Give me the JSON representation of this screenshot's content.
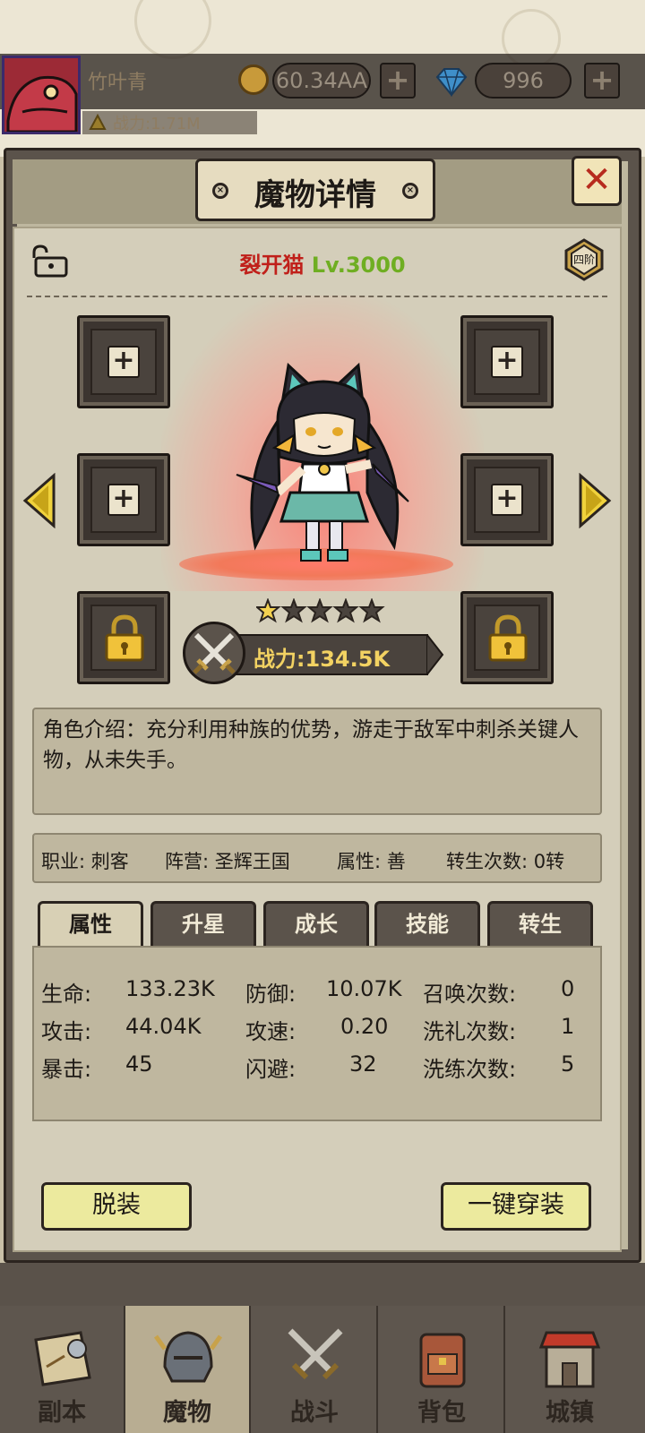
{
  "player": {
    "name": "竹叶青",
    "power": "战力:1.71M",
    "gold": "60.34AA",
    "gems": "996"
  },
  "dialog": {
    "title": "魔物详情"
  },
  "monster": {
    "name": "裂开猫",
    "level": "Lv.3000",
    "tier": "四阶",
    "stars_filled": 1,
    "stars_total": 5,
    "power": "战力:134.5K",
    "description": "角色介绍：充分利用种族的优势，游走于敌军中刺杀关键人物，从未失手。"
  },
  "info": {
    "job": "职业: 刺客",
    "faction": "阵营: 圣辉王国",
    "attribute": "属性: 善",
    "rebirth": "转生次数: 0转"
  },
  "tabs": [
    "属性",
    "升星",
    "成长",
    "技能",
    "转生"
  ],
  "stats": {
    "hp_label": "生命:",
    "hp": "133.23K",
    "def_label": "防御:",
    "def": "10.07K",
    "summon_label": "召唤次数:",
    "summon": "0",
    "atk_label": "攻击:",
    "atk": "44.04K",
    "spd_label": "攻速:",
    "spd": "0.20",
    "baptism_label": "洗礼次数:",
    "baptism": "1",
    "crit_label": "暴击:",
    "crit": "45",
    "dodge_label": "闪避:",
    "dodge": "32",
    "refine_label": "洗练次数:",
    "refine": "5"
  },
  "buttons": {
    "unequip": "脱装",
    "equip_all": "一键穿装"
  },
  "nav": [
    "副本",
    "魔物",
    "战斗",
    "背包",
    "城镇"
  ],
  "colors": {
    "name_red": "#c0201a",
    "level_green": "#6fae22",
    "power_gold": "#f2d262"
  }
}
